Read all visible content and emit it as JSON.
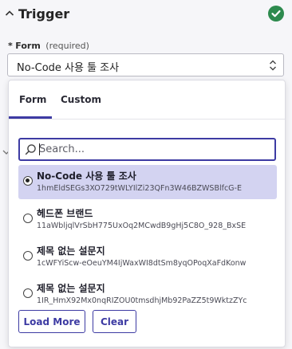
{
  "header": {
    "title": "Trigger",
    "status_color": "#2d8a4e"
  },
  "form_field": {
    "required_marker": "*",
    "label": "Form",
    "required_text": "(required)",
    "selected_value": "No-Code 사용 툴 조사"
  },
  "dropdown": {
    "tabs": [
      {
        "label": "Form",
        "active": true
      },
      {
        "label": "Custom",
        "active": false
      }
    ],
    "search": {
      "placeholder": "Search...",
      "value": ""
    },
    "items": [
      {
        "title": "No-Code 사용 툴 조사",
        "id": "1hmEldSEGs3XO729tWLYIlZi23QFn3W46BZWSBlfcG-E",
        "selected": true
      },
      {
        "title": "헤드폰 브랜드",
        "id": "11aWbljqlVrSbH775UxOq2MCwdB9gHj5C8O_928_BxSE",
        "selected": false
      },
      {
        "title": "제목 없는 설문지",
        "id": "1cWFYiScw-eOeuYM4IjWaxWI8dtSm8yqOPoqXaFdKonw",
        "selected": false
      },
      {
        "title": "제목 없는 설문지",
        "id": "1IR_HmX92Mx0nqRIZOU0tmsdhjMb92PaZZ5t9WktzZYc",
        "selected": false
      }
    ],
    "buttons": {
      "load_more": "Load More",
      "clear": "Clear"
    }
  },
  "colors": {
    "accent": "#3d3ba3",
    "selected_bg": "#d3d3f1",
    "success": "#2d8a4e"
  }
}
